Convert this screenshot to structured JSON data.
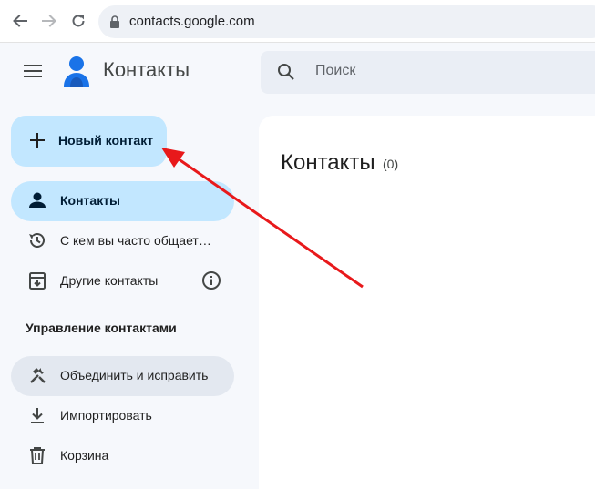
{
  "browser": {
    "url": "contacts.google.com",
    "icons": [
      "back-arrow-icon",
      "forward-arrow-icon",
      "reload-icon",
      "lock-icon"
    ]
  },
  "header": {
    "title": "Контакты",
    "search_placeholder": "Поиск"
  },
  "create_button": {
    "label": "Новый контакт"
  },
  "sidebar": {
    "items": [
      {
        "label": "Контакты",
        "icon": "person-icon",
        "state": "selected"
      },
      {
        "label": "С кем вы часто общает…",
        "icon": "history-icon"
      },
      {
        "label": "Другие контакты",
        "icon": "archive-icon"
      }
    ],
    "section_title": "Управление контактами",
    "manage_items": [
      {
        "label": "Объединить и исправить",
        "icon": "merge-tools-icon",
        "state": "hovered"
      },
      {
        "label": "Импортировать",
        "icon": "import-icon"
      },
      {
        "label": "Корзина",
        "icon": "trash-icon"
      }
    ]
  },
  "main": {
    "title": "Контакты",
    "count": "(0)"
  },
  "colors": {
    "accent": "#c2e7ff",
    "annotation": "#e8191b",
    "background": "#f6f8fc"
  }
}
